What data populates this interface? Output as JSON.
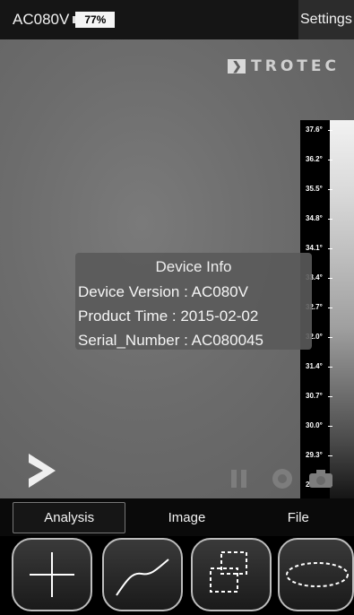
{
  "header": {
    "device_name": "AC080V",
    "battery_text": "77%",
    "settings_label": "Settings"
  },
  "brand": {
    "name": "TROTEC"
  },
  "scale": {
    "ticks": [
      "37.6°",
      "36.2°",
      "35.5°",
      "34.8°",
      "34.1°",
      "33.4°",
      "32.7°",
      "32.0°",
      "31.4°",
      "30.7°",
      "30.0°",
      "29.3°",
      "28.6°"
    ]
  },
  "device_info": {
    "title": "Device Info",
    "version": "Device Version : AC080V",
    "product_time": "Product Time : 2015-02-02",
    "serial": "Serial_Number : AC080045"
  },
  "tabs": [
    {
      "label": "Analysis"
    },
    {
      "label": "Image"
    },
    {
      "label": "File"
    }
  ],
  "tools": [
    {
      "icon": "crosshair-icon"
    },
    {
      "icon": "curve-line-icon"
    },
    {
      "icon": "overlapping-rectangles-icon"
    },
    {
      "icon": "ellipse-icon"
    }
  ]
}
